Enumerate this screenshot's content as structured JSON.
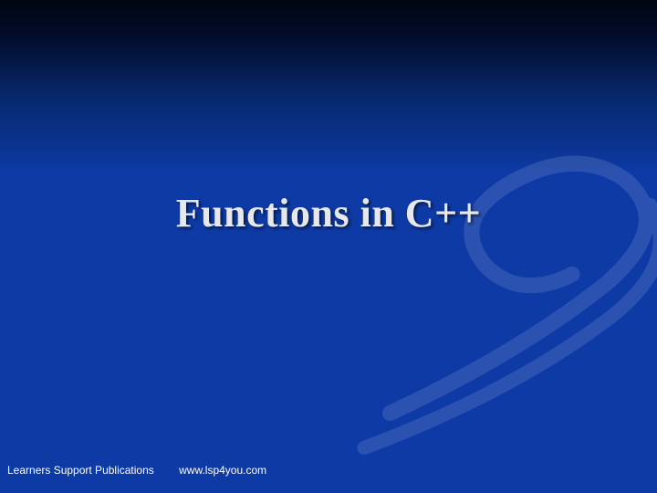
{
  "slide": {
    "title": "Functions in C++",
    "footer": {
      "publisher": "Learners Support Publications",
      "url": "www.lsp4you.com"
    }
  }
}
